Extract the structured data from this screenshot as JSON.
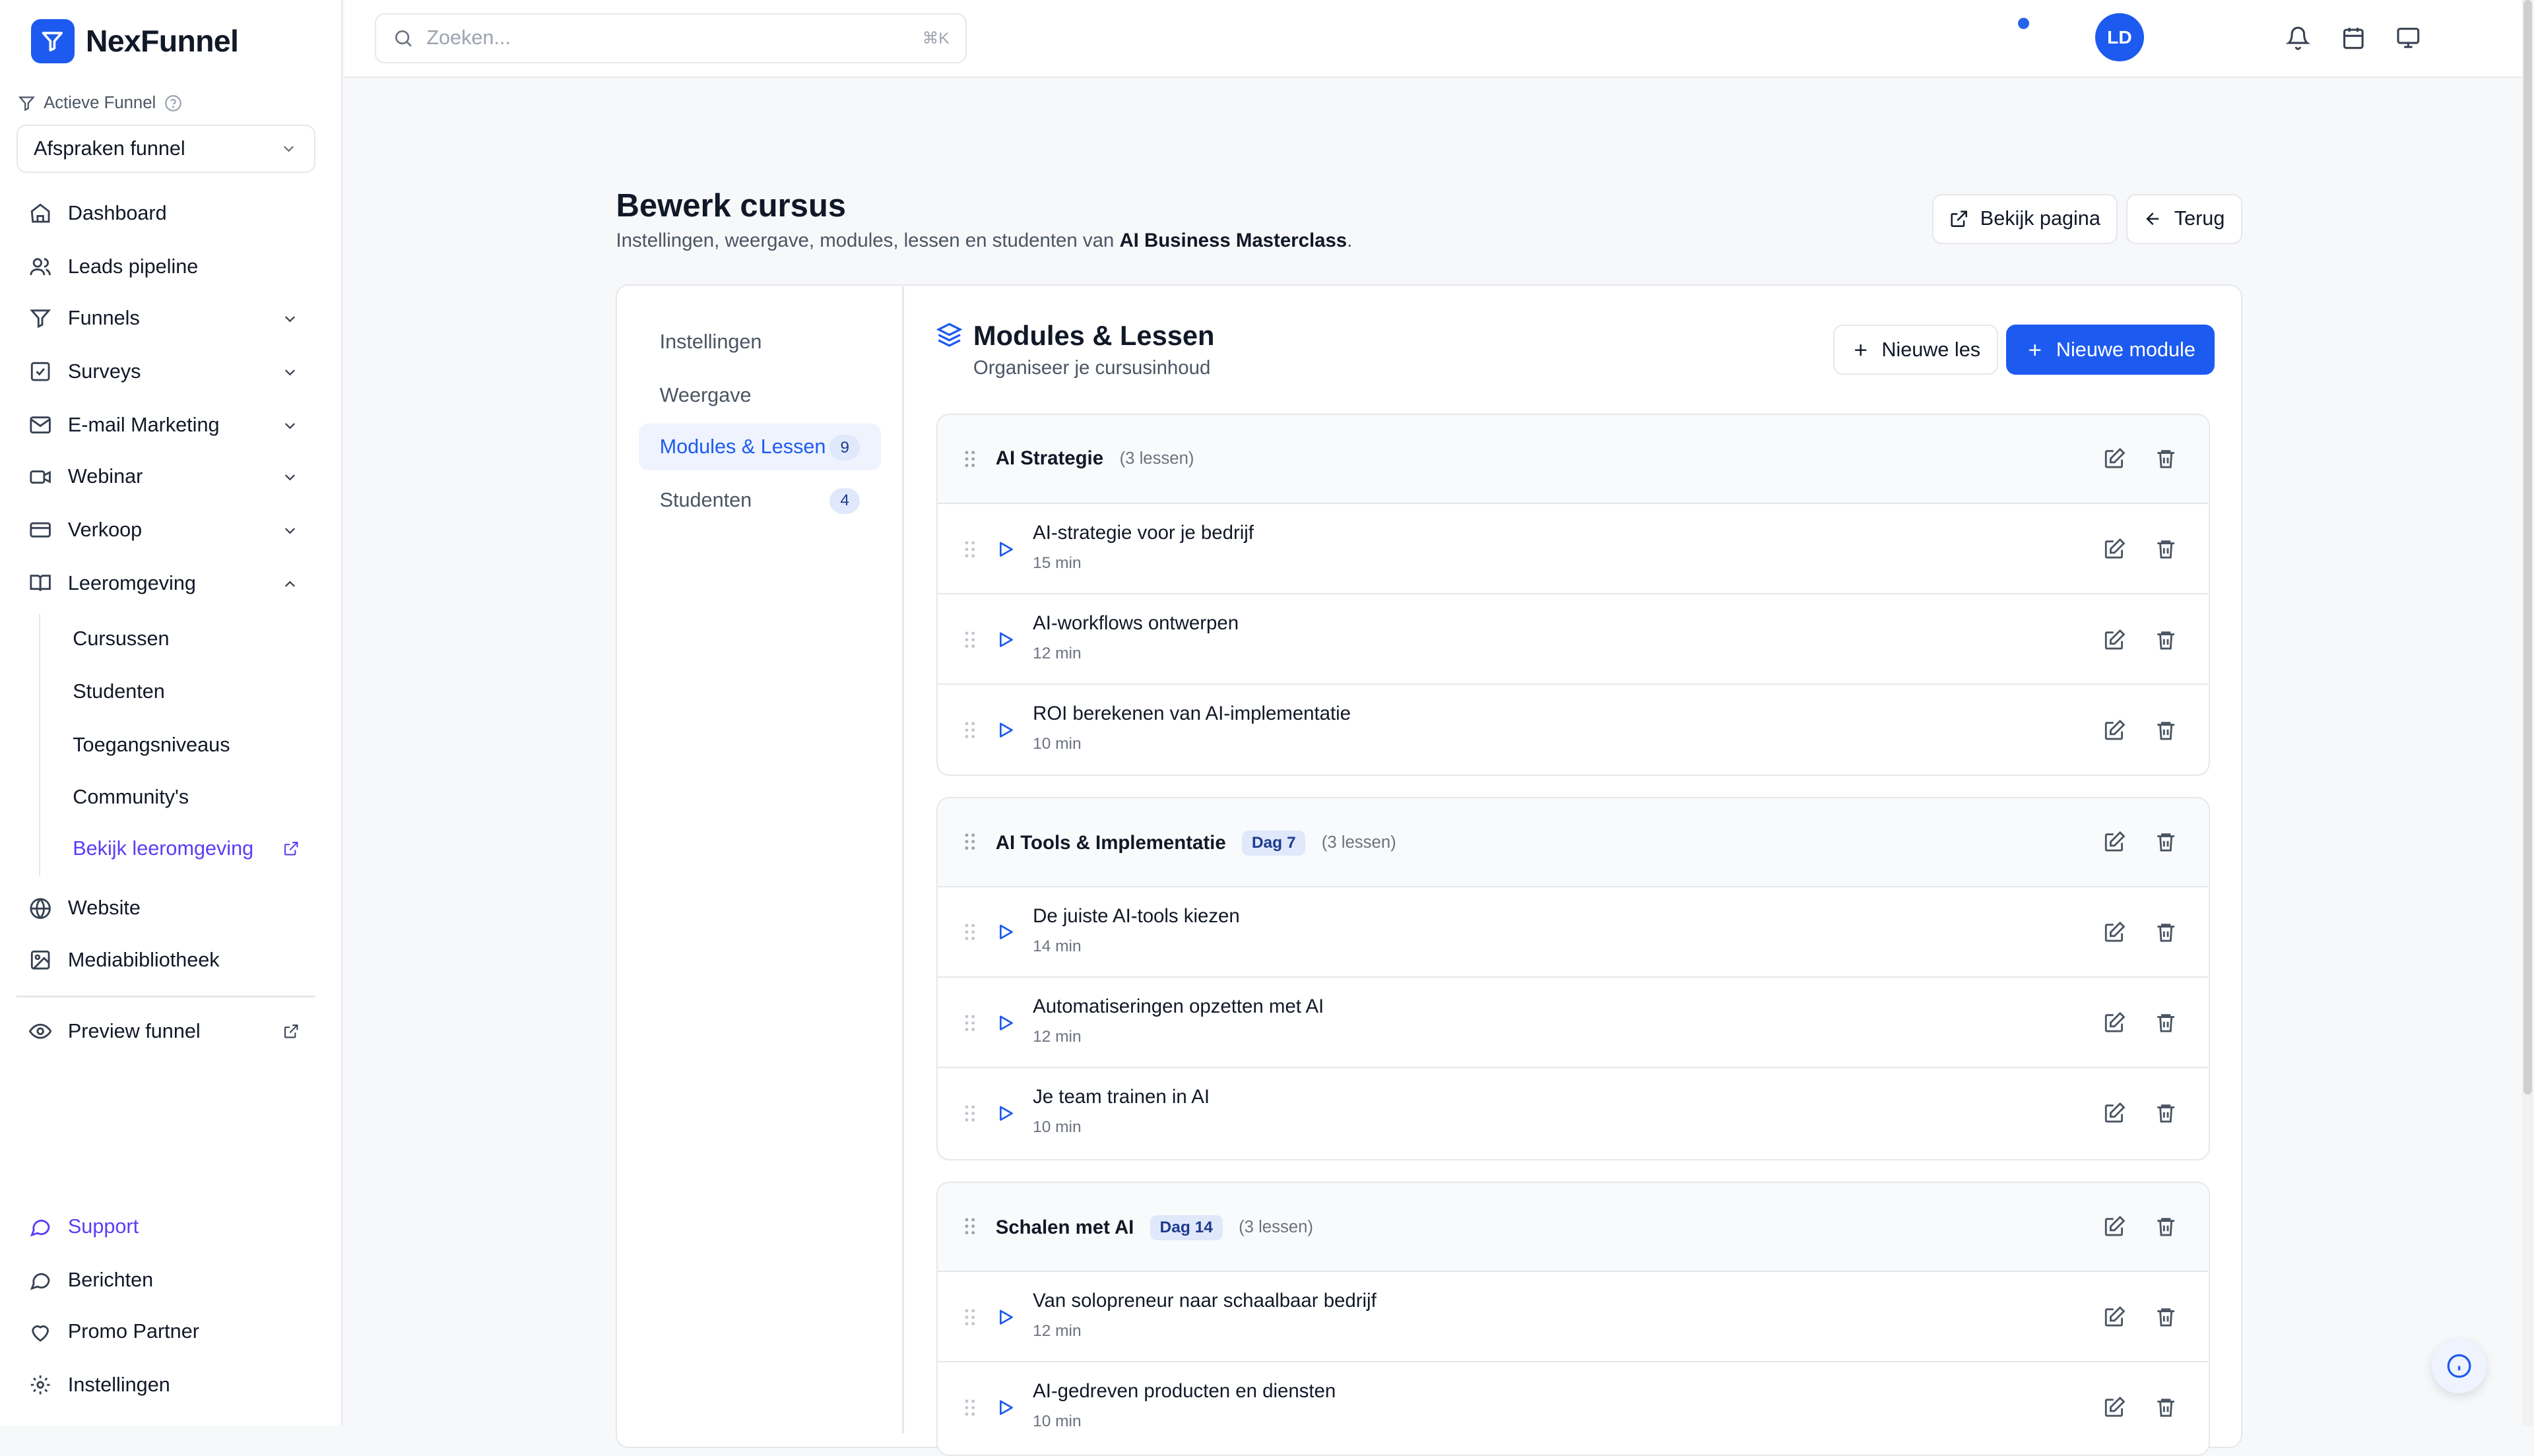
{
  "brand": {
    "name": "NexFunnel",
    "accent": "#1d5bf0"
  },
  "sidebar": {
    "funnel_label": "Actieve Funnel",
    "funnel_selected": "Afspraken funnel",
    "nav": [
      {
        "label": "Dashboard"
      },
      {
        "label": "Leads pipeline"
      },
      {
        "label": "Funnels"
      },
      {
        "label": "Surveys"
      },
      {
        "label": "E-mail Marketing"
      },
      {
        "label": "Webinar"
      },
      {
        "label": "Verkoop"
      },
      {
        "label": "Leeromgeving"
      }
    ],
    "sub": [
      {
        "label": "Cursussen"
      },
      {
        "label": "Studenten"
      },
      {
        "label": "Toegangsniveaus"
      },
      {
        "label": "Community's"
      },
      {
        "label": "Bekijk leeromgeving"
      }
    ],
    "more": [
      {
        "label": "Website"
      },
      {
        "label": "Mediabibliotheek"
      },
      {
        "label": "Preview funnel"
      }
    ],
    "bottom": [
      {
        "label": "Support"
      },
      {
        "label": "Berichten"
      },
      {
        "label": "Promo Partner"
      },
      {
        "label": "Instellingen"
      }
    ]
  },
  "topbar": {
    "search_placeholder": "Zoeken...",
    "shortcut": "⌘K",
    "avatar_initials": "LD"
  },
  "page": {
    "title": "Bewerk cursus",
    "subtitle_prefix": "Instellingen, weergave, modules, lessen en studenten van ",
    "course_name": "AI Business Masterclass",
    "subtitle_suffix": ".",
    "view_button": "Bekijk pagina",
    "back_button": "Terug"
  },
  "tabs": [
    {
      "label": "Instellingen"
    },
    {
      "label": "Weergave"
    },
    {
      "label": "Modules & Lessen",
      "count": "9"
    },
    {
      "label": "Studenten",
      "count": "4"
    }
  ],
  "section": {
    "title": "Modules & Lessen",
    "subtitle": "Organiseer je cursusinhoud",
    "new_lesson": "Nieuwe les",
    "new_module": "Nieuwe module"
  },
  "modules": [
    {
      "title": "AI Strategie",
      "badge": "",
      "meta": "(3 lessen)",
      "lessons": [
        {
          "title": "AI-strategie voor je bedrijf",
          "duration": "15 min"
        },
        {
          "title": "AI-workflows ontwerpen",
          "duration": "12 min"
        },
        {
          "title": "ROI berekenen van AI-implementatie",
          "duration": "10 min"
        }
      ]
    },
    {
      "title": "AI Tools & Implementatie",
      "badge": "Dag 7",
      "meta": "(3 lessen)",
      "lessons": [
        {
          "title": "De juiste AI-tools kiezen",
          "duration": "14 min"
        },
        {
          "title": "Automatiseringen opzetten met AI",
          "duration": "12 min"
        },
        {
          "title": "Je team trainen in AI",
          "duration": "10 min"
        }
      ]
    },
    {
      "title": "Schalen met AI",
      "badge": "Dag 14",
      "meta": "(3 lessen)",
      "lessons": [
        {
          "title": "Van solopreneur naar schaalbaar bedrijf",
          "duration": "12 min"
        },
        {
          "title": "AI-gedreven producten en diensten",
          "duration": "10 min"
        }
      ]
    }
  ]
}
